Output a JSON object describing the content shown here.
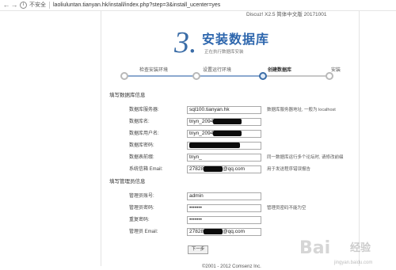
{
  "browser": {
    "back": "←",
    "forward": "→",
    "reload": "C",
    "info_icon": "i",
    "secure_label": "不安全",
    "url": "laoliuluntan.tianyan.hk/install/index.php?step=3&install_ucenter=yes"
  },
  "installer": {
    "version": "Discuz! X2.5 简体中文版 20171001",
    "step_number": "3.",
    "step_title": "安装数据库",
    "step_subtitle": "正在执行数据库安装",
    "steps": [
      {
        "label": "检查安装环境",
        "state": "done"
      },
      {
        "label": "设置运行环境",
        "state": "done"
      },
      {
        "label": "创建数据库",
        "state": "active"
      },
      {
        "label": "安装",
        "state": "pending"
      }
    ],
    "db_section": {
      "title": "填写数据库信息",
      "rows": [
        {
          "label": "数据库服务器:",
          "value": "sql100.tianyan.hk",
          "hint": "数据库服务器地址, 一般为 localhost"
        },
        {
          "label": "数据库名:",
          "value": "tnyn_2094",
          "hint": ""
        },
        {
          "label": "数据库用户名:",
          "value": "tnyn_2094",
          "hint": ""
        },
        {
          "label": "数据库密码:",
          "value": "",
          "hint": ""
        },
        {
          "label": "数据表前缀:",
          "value": "tnyn_",
          "hint": "同一数据库运行多个论坛时, 请修改前缀"
        },
        {
          "label": "系统信箱 Email:",
          "value": "27828",
          "value_suffix": "@qq.com",
          "hint": "用于发送程序错误报告"
        }
      ]
    },
    "admin_section": {
      "title": "填写管理员信息",
      "rows": [
        {
          "label": "管理员账号:",
          "value": "admin",
          "hint": ""
        },
        {
          "label": "管理员密码:",
          "value": "•••••••",
          "hint": "管理员密码不能为空"
        },
        {
          "label": "重复密码:",
          "value": "•••••••",
          "hint": ""
        },
        {
          "label": "管理员 Email:",
          "value": "27828",
          "value_suffix": "@qq.com",
          "hint": ""
        }
      ]
    },
    "next_button": "下一步",
    "copyright": "©2001 - 2012 Comsenz Inc."
  },
  "watermark": {
    "logo": "Bai",
    "text": "经验",
    "site": "jingyan.baidu.com"
  }
}
